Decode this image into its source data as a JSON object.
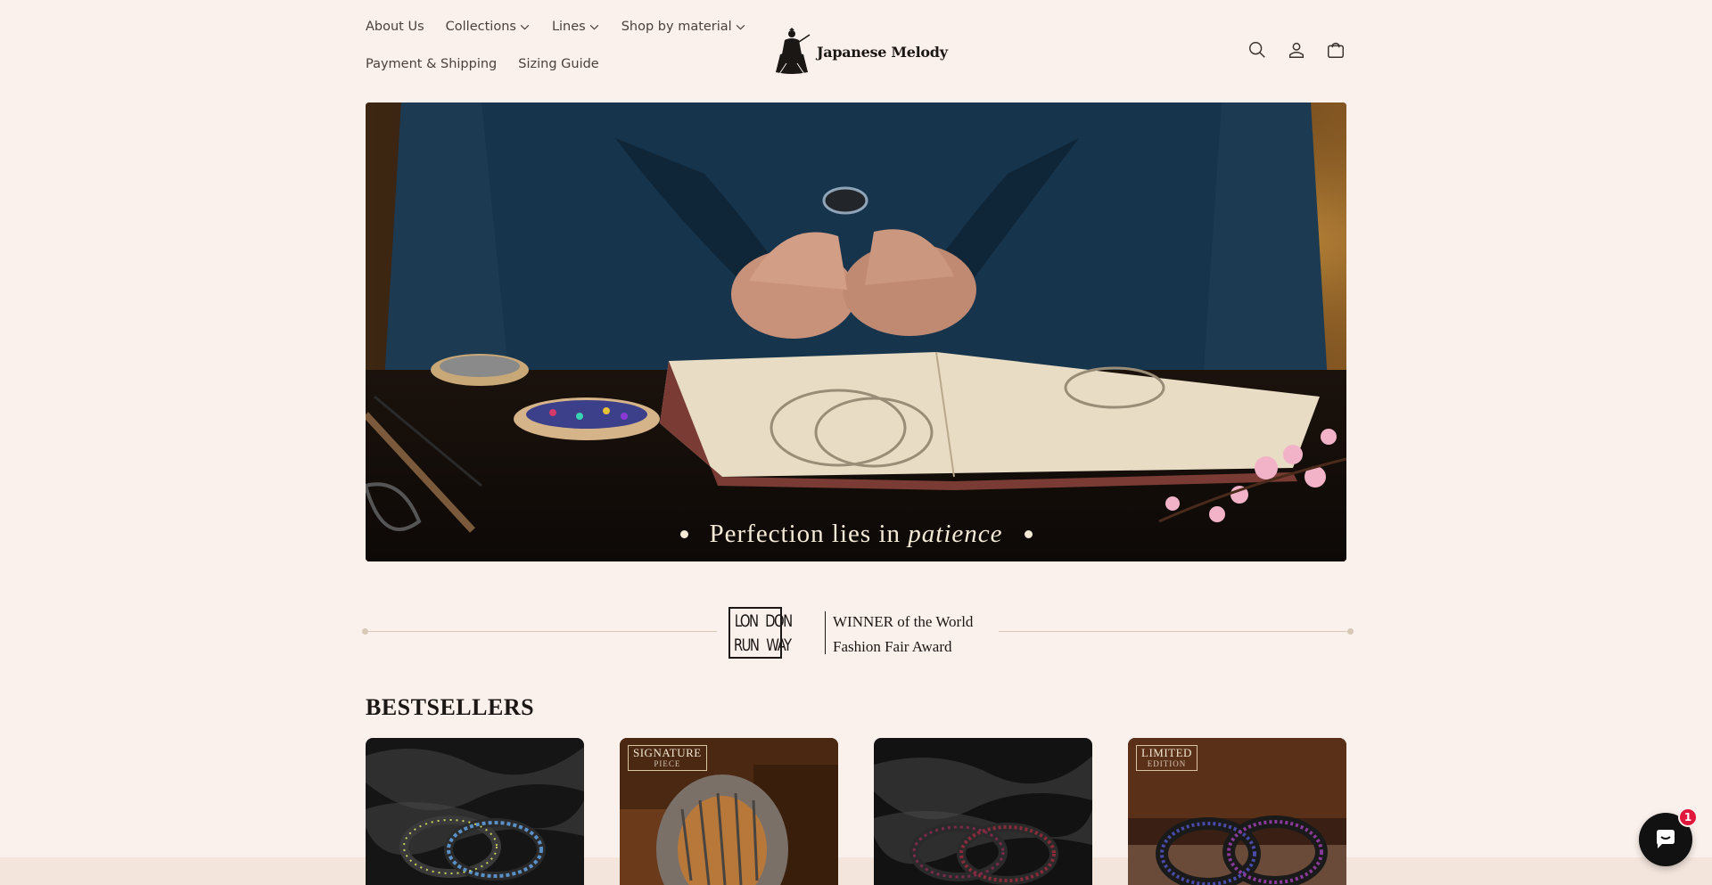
{
  "nav": {
    "items": [
      {
        "label": "About Us",
        "dropdown": false
      },
      {
        "label": "Collections",
        "dropdown": true
      },
      {
        "label": "Lines",
        "dropdown": true
      },
      {
        "label": "Shop by material",
        "dropdown": true
      },
      {
        "label": "Payment & Shipping",
        "dropdown": false
      },
      {
        "label": "Sizing Guide",
        "dropdown": false
      }
    ]
  },
  "brand": {
    "name": "Japanese Melody"
  },
  "header_icons": [
    "search-icon",
    "account-icon",
    "cart-icon"
  ],
  "hero": {
    "caption_prefix": "Perfection lies in",
    "caption_emphasis": "patience"
  },
  "award": {
    "logo_left": [
      "LON",
      "RUN"
    ],
    "logo_right": [
      "DON",
      "WAY"
    ],
    "line1": "WINNER of the World",
    "line2": "Fashion Fair Award"
  },
  "bestsellers": {
    "title": "BESTSELLERS",
    "products": [
      {
        "badge": null
      },
      {
        "badge": {
          "line1": "SIGNATURE",
          "line2": "PIECE"
        }
      },
      {
        "badge": null
      },
      {
        "badge": {
          "line1": "LIMITED",
          "line2": "EDITION"
        }
      }
    ]
  },
  "chat": {
    "unread_count": "1"
  },
  "colors": {
    "background": "#fbf1ec",
    "accent_badge": "#e0183c",
    "text": "#3a3330"
  }
}
